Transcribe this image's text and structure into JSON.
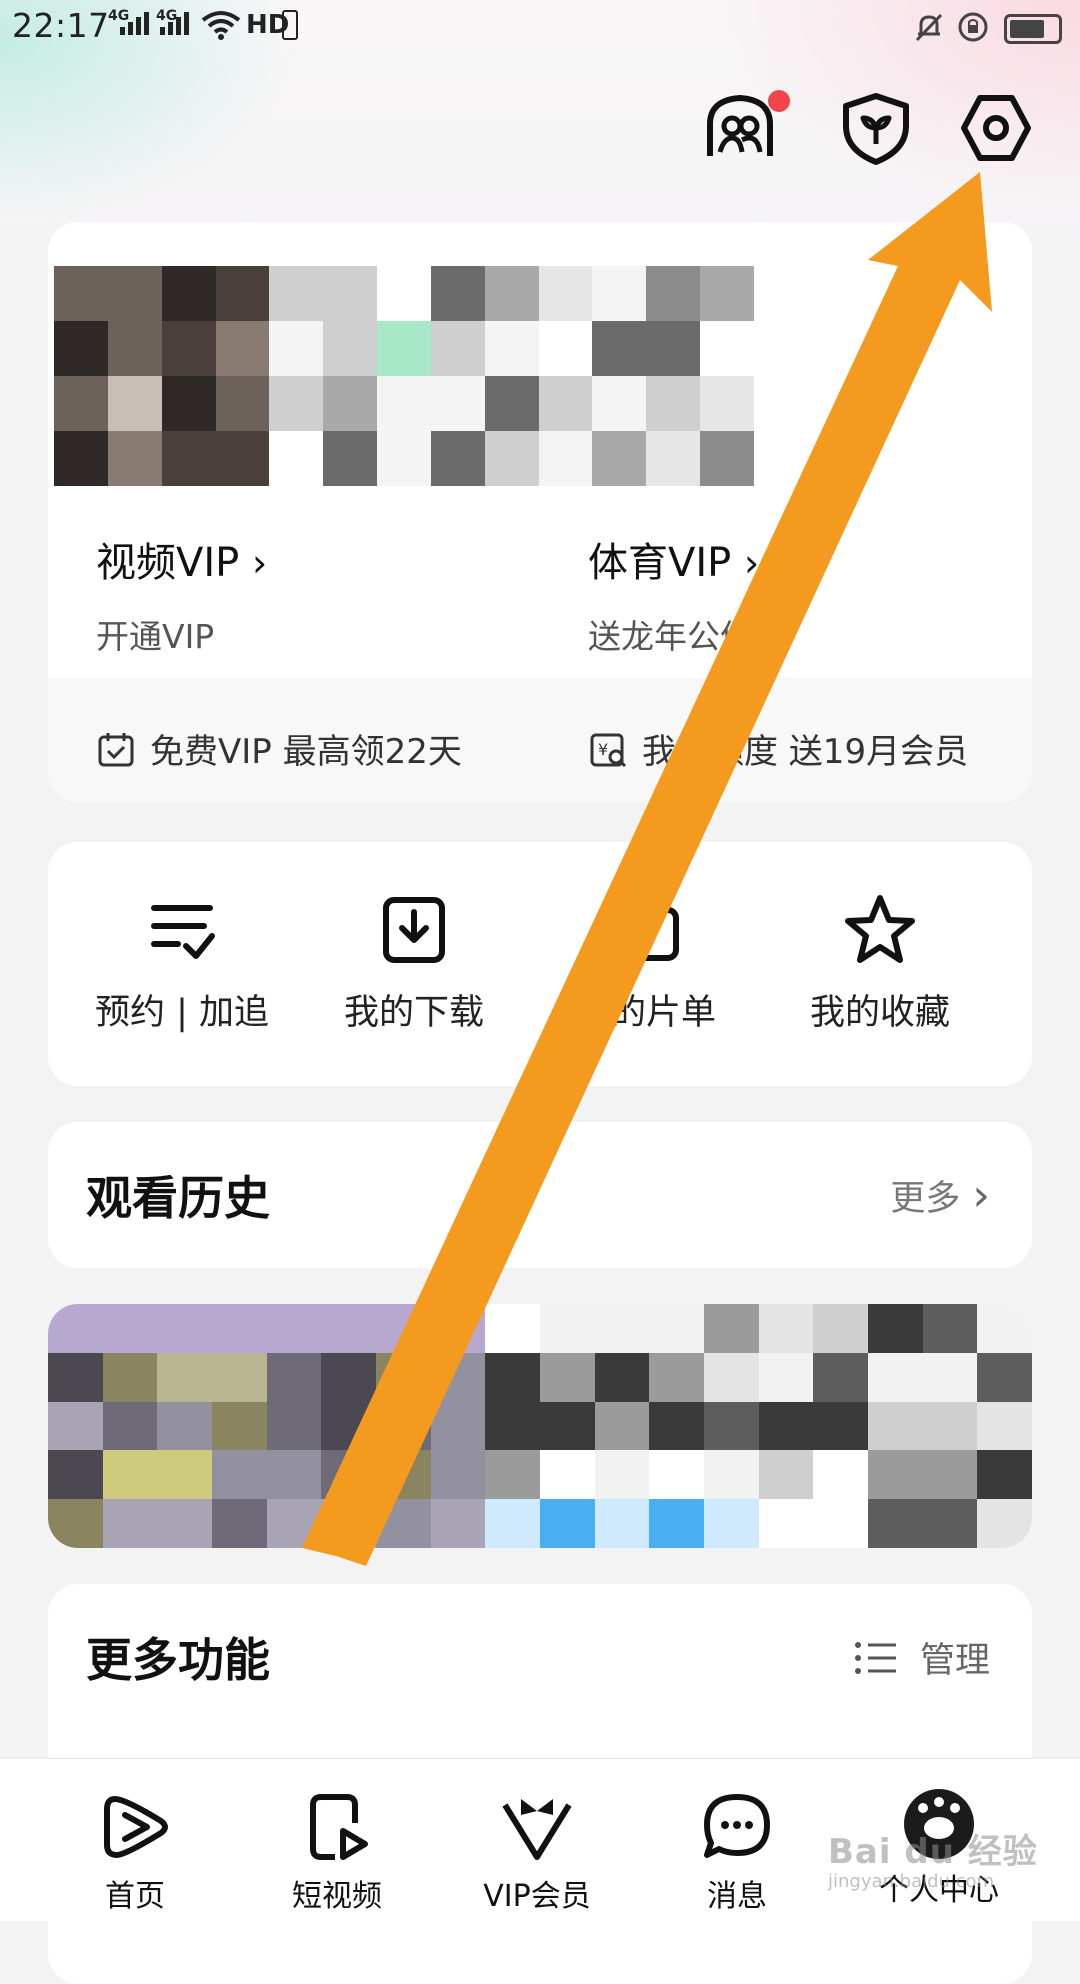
{
  "status_bar": {
    "time": "22:17",
    "signal_1": "4G",
    "signal_2": "4G",
    "hd": "HD"
  },
  "top_icons": [
    "friends-icon",
    "shield-icon",
    "settings-icon"
  ],
  "vip_card": {
    "video_vip": {
      "title": "视频VIP",
      "subtitle": "开通VIP"
    },
    "sports_vip": {
      "title": "体育VIP",
      "subtitle": "送龙年公仔"
    },
    "free_vip": "免费VIP 最高领22天",
    "my_quota": "我的额度 送19月会员"
  },
  "quick_actions": [
    {
      "label": "预约 | 加追",
      "icon": "checklist-icon"
    },
    {
      "label": "我的下载",
      "icon": "download-icon"
    },
    {
      "label": "我的片单",
      "icon": "playlist-icon"
    },
    {
      "label": "我的收藏",
      "icon": "star-icon"
    }
  ],
  "history": {
    "title": "观看历史",
    "more": "更多"
  },
  "more_functions": {
    "title": "更多功能",
    "manage": "管理"
  },
  "bottom_nav": [
    {
      "label": "首页",
      "icon": "home-play-icon"
    },
    {
      "label": "短视频",
      "icon": "short-video-icon"
    },
    {
      "label": "VIP会员",
      "icon": "vip-icon"
    },
    {
      "label": "消息",
      "icon": "message-icon"
    },
    {
      "label": "个人中心",
      "icon": "avatar"
    }
  ],
  "watermark": {
    "brand": "Bai du 经验",
    "url": "jingyan.baidu.com"
  },
  "colors": {
    "accent_arrow": "#f39a1f",
    "badge_red": "#f2444b"
  }
}
